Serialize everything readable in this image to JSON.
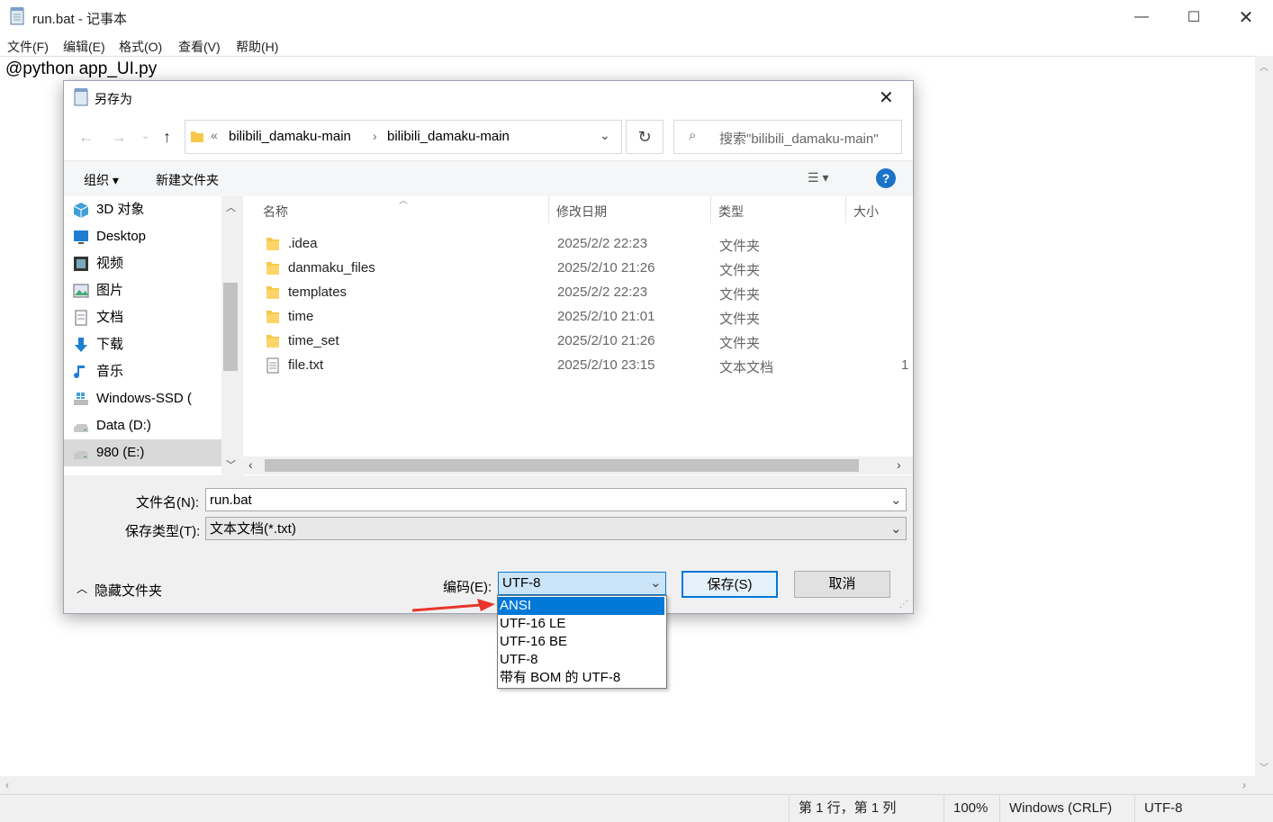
{
  "notepad": {
    "title": "run.bat - 记事本",
    "menu": [
      "文件(F)",
      "编辑(E)",
      "格式(O)",
      "查看(V)",
      "帮助(H)"
    ],
    "content": "@python app_UI.py",
    "status": {
      "position": "第 1 行，第 1 列",
      "zoom": "100%",
      "line_ending": "Windows (CRLF)",
      "encoding": "UTF-8"
    }
  },
  "dialog": {
    "title": "另存为",
    "breadcrumb": {
      "chevron": "«",
      "parts": [
        "bilibili_damaku-main",
        "bilibili_damaku-main"
      ]
    },
    "search_placeholder": "搜索\"bilibili_damaku-main\"",
    "toolbar": {
      "organize": "组织 ▾",
      "new_folder": "新建文件夹",
      "help": "?"
    },
    "nav_items": [
      {
        "label": "3D 对象",
        "icon": "3d-objects-icon"
      },
      {
        "label": "Desktop",
        "icon": "desktop-icon"
      },
      {
        "label": "视频",
        "icon": "video-icon"
      },
      {
        "label": "图片",
        "icon": "pictures-icon"
      },
      {
        "label": "文档",
        "icon": "documents-icon"
      },
      {
        "label": "下载",
        "icon": "downloads-icon"
      },
      {
        "label": "音乐",
        "icon": "music-icon"
      },
      {
        "label": "Windows-SSD (",
        "icon": "windows-drive-icon"
      },
      {
        "label": "Data (D:)",
        "icon": "drive-icon"
      },
      {
        "label": "980 (E:)",
        "icon": "drive-icon",
        "selected": true
      }
    ],
    "columns": [
      "名称",
      "修改日期",
      "类型",
      "大小"
    ],
    "files": [
      {
        "name": ".idea",
        "date": "2025/2/2 22:23",
        "type": "文件夹",
        "size": "",
        "icon": "folder-icon"
      },
      {
        "name": "danmaku_files",
        "date": "2025/2/10 21:26",
        "type": "文件夹",
        "size": "",
        "icon": "folder-icon"
      },
      {
        "name": "templates",
        "date": "2025/2/2 22:23",
        "type": "文件夹",
        "size": "",
        "icon": "folder-icon"
      },
      {
        "name": "time",
        "date": "2025/2/10 21:01",
        "type": "文件夹",
        "size": "",
        "icon": "folder-icon"
      },
      {
        "name": "time_set",
        "date": "2025/2/10 21:26",
        "type": "文件夹",
        "size": "",
        "icon": "folder-icon"
      },
      {
        "name": "file.txt",
        "date": "2025/2/10 23:15",
        "type": "文本文档",
        "size": "1",
        "icon": "text-file-icon"
      }
    ],
    "filename_label": "文件名(N):",
    "filename_value": "run.bat",
    "filetype_label": "保存类型(T):",
    "filetype_value": "文本文档(*.txt)",
    "hide_folders": "隐藏文件夹",
    "encoding_label": "编码(E):",
    "encoding_value": "UTF-8",
    "save_button": "保存(S)",
    "cancel_button": "取消",
    "encoding_options": [
      "ANSI",
      "UTF-16 LE",
      "UTF-16 BE",
      "UTF-8",
      "带有 BOM 的 UTF-8"
    ],
    "highlighted_option": "ANSI"
  },
  "annotation_color": "#e8352c"
}
